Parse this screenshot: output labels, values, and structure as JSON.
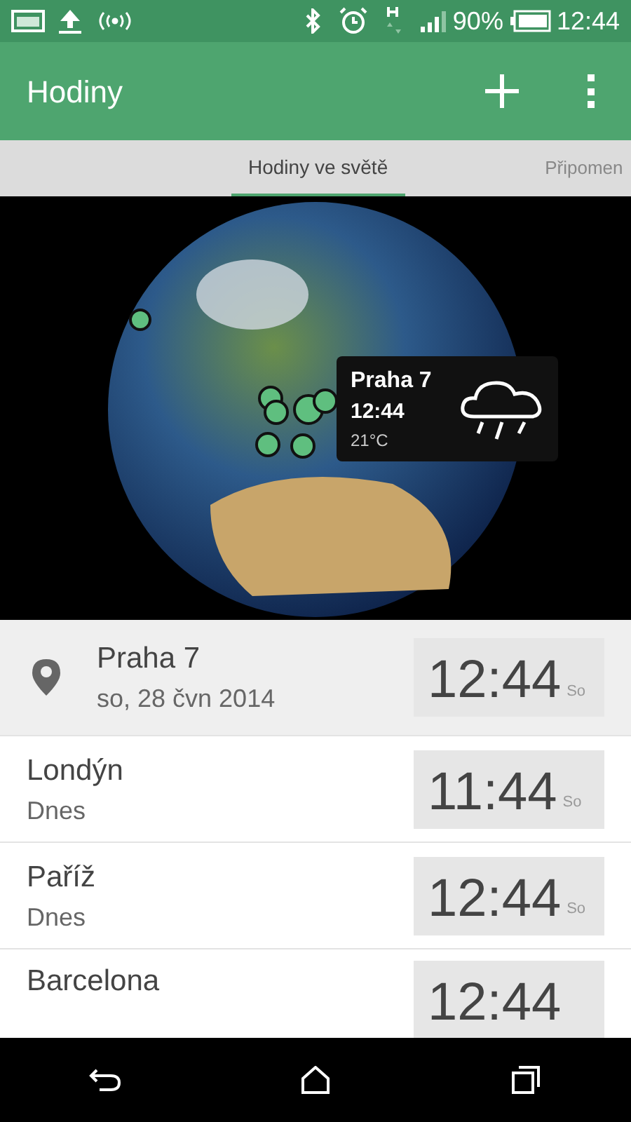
{
  "status_bar": {
    "battery": "90%",
    "time": "12:44"
  },
  "app_bar": {
    "title": "Hodiny"
  },
  "tabs": [
    {
      "label": "Hodiny ve světě",
      "selected": true
    },
    {
      "label": "Připomen",
      "selected": false
    }
  ],
  "map_popup": {
    "city": "Praha 7",
    "time": "12:44",
    "temperature": "21°C"
  },
  "clocks": [
    {
      "kind": "current",
      "city": "Praha 7",
      "date": "so, 28 čvn 2014",
      "time": "12:44",
      "day": "So"
    },
    {
      "kind": "city",
      "city": "Londýn",
      "date": "Dnes",
      "time": "11:44",
      "day": "So"
    },
    {
      "kind": "city",
      "city": "Paříž",
      "date": "Dnes",
      "time": "12:44",
      "day": "So"
    },
    {
      "kind": "city",
      "city": "Barcelona",
      "time": "12:44"
    }
  ]
}
